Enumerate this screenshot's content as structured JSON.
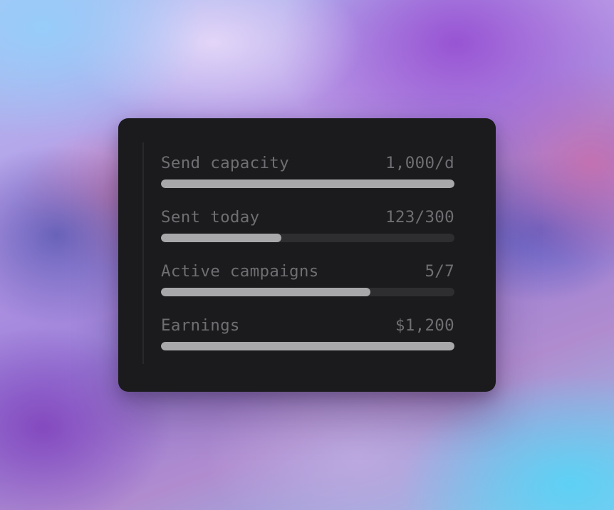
{
  "theme": {
    "card_background": "#1b1b1d",
    "text_color": "#6f6f73",
    "bar_fill_color": "#a8a8aa",
    "bar_track_color": "#2e2e31"
  },
  "metrics": [
    {
      "label": "Send capacity",
      "value": "1,000/d",
      "progress": 1.0
    },
    {
      "label": "Sent today",
      "value": "123/300",
      "progress": 0.41
    },
    {
      "label": "Active campaigns",
      "value": "5/7",
      "progress": 0.714
    },
    {
      "label": "Earnings",
      "value": "$1,200",
      "progress": 1.0
    }
  ]
}
